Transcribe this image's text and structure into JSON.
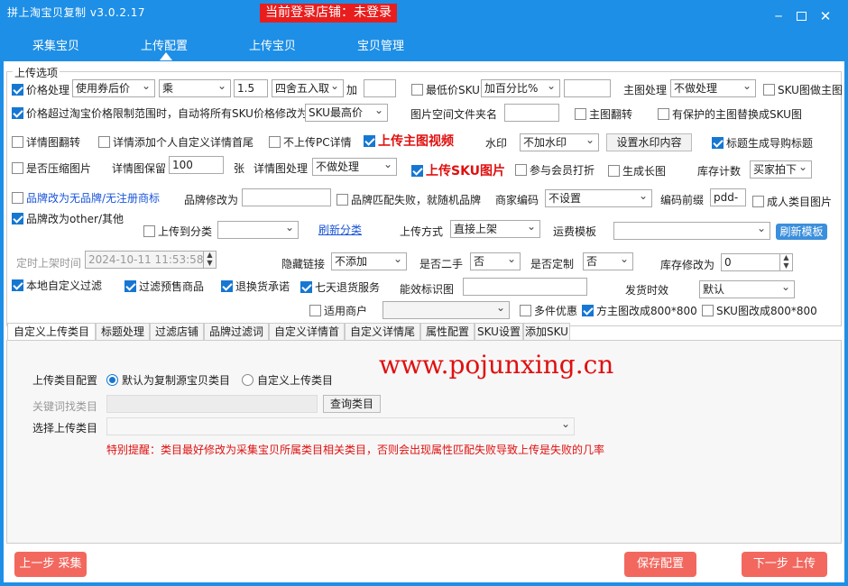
{
  "app": {
    "title": "拼上淘宝贝复制 v3.0.2.17",
    "store_status": "当前登录店铺：未登录"
  },
  "nav": {
    "tabs": [
      "采集宝贝",
      "上传配置",
      "上传宝贝",
      "宝贝管理"
    ],
    "active": "上传配置"
  },
  "options": {
    "group_title": "上传选项",
    "price_processing": {
      "label": "价格处理",
      "checked": true,
      "mode": "使用券后价",
      "operator": "乘",
      "factor": "1.5",
      "rounding": "四舍五入取",
      "add_label": "加",
      "add_value": ""
    },
    "min_price_sku": {
      "label": "最低价SKU",
      "checked": false,
      "mode": "加百分比%",
      "value": ""
    },
    "main_image_processing": {
      "label": "主图处理",
      "value": "不做处理"
    },
    "sku_as_main": {
      "label": "SKU图做主图",
      "checked": false
    },
    "price_limit": {
      "label": "价格超过淘宝价格限制范围时，自动将所有SKU价格修改为",
      "checked": true,
      "value": "SKU最高价"
    },
    "image_folder": {
      "label": "图片空间文件夹名",
      "value": ""
    },
    "main_flip": {
      "label": "主图翻转",
      "checked": false
    },
    "protected_main_replace": {
      "label": "有保护的主图替换成SKU图",
      "checked": false
    },
    "detail_flip": {
      "label": "详情图翻转",
      "checked": false
    },
    "detail_custom_header": {
      "label": "详情添加个人自定义详情首尾",
      "checked": false
    },
    "no_pc_detail": {
      "label": "不上传PC详情",
      "checked": false
    },
    "upload_main_video": {
      "label": "上传主图视频",
      "checked": true
    },
    "watermark": {
      "label": "水印",
      "value": "不加水印",
      "button": "设置水印内容"
    },
    "title_guide": {
      "label": "标题生成导购标题",
      "checked": true
    },
    "compress_images": {
      "label": "是否压缩图片",
      "checked": false
    },
    "detail_keep": {
      "label": "详情图保留",
      "value": "100",
      "unit": "张"
    },
    "detail_processing": {
      "label": "详情图处理",
      "value": "不做处理"
    },
    "upload_sku_images": {
      "label": "上传SKU图片",
      "checked": true
    },
    "member_discount": {
      "label": "参与会员打折",
      "checked": false
    },
    "long_image": {
      "label": "生成长图",
      "checked": false
    },
    "stock_count": {
      "label": "库存计数",
      "value": "买家拍下"
    },
    "brand_none": {
      "label": "品牌改为无品牌/无注册商标",
      "checked": false
    },
    "brand_modify": {
      "label": "品牌修改为",
      "value": ""
    },
    "brand_fail_random": {
      "label": "品牌匹配失败，就随机品牌",
      "checked": false
    },
    "merchant_code": {
      "label": "商家编码",
      "value": "不设置"
    },
    "code_prefix": {
      "label": "编码前缀",
      "value": "pdd-"
    },
    "adult_category": {
      "label": "成人类目图片",
      "checked": false
    },
    "brand_other": {
      "label": "品牌改为other/其他",
      "checked": true
    },
    "upload_to_category": {
      "label": "上传到分类",
      "checked": false,
      "value": ""
    },
    "refresh_category": "刷新分类",
    "upload_mode": {
      "label": "上传方式",
      "value": "直接上架"
    },
    "shipping_template": {
      "label": "运费模板",
      "value": "",
      "button": "刷新模板"
    },
    "scheduled": {
      "label": "定时上架时间",
      "value": "2024-10-11 11:53:58"
    },
    "hidden_link": {
      "label": "隐藏链接",
      "value": "不添加"
    },
    "second_hand": {
      "label": "是否二手",
      "value": "否"
    },
    "customized": {
      "label": "是否定制",
      "value": "否"
    },
    "stock_modify": {
      "label": "库存修改为",
      "value": "0"
    },
    "local_filter": {
      "label": "本地自定义过滤",
      "checked": true
    },
    "filter_presale": {
      "label": "过滤预售商品",
      "checked": true
    },
    "return_promise": {
      "label": "退换货承诺",
      "checked": true
    },
    "seven_day": {
      "label": "七天退货服务",
      "checked": true
    },
    "efficacy_image": {
      "label": "能效标识图",
      "value": ""
    },
    "ship_time": {
      "label": "发货时效",
      "value": "默认"
    },
    "applicable_merchant": {
      "label": "适用商户",
      "checked": false,
      "value": ""
    },
    "multi_discount": {
      "label": "多件优惠",
      "checked": false
    },
    "square_main": {
      "label": "方主图改成800*800",
      "checked": true
    },
    "sku_800": {
      "label": "SKU图改成800*800",
      "checked": false
    }
  },
  "subtabs": [
    "自定义上传类目",
    "标题处理",
    "过滤店铺",
    "品牌过滤词",
    "自定义详情首",
    "自定义详情尾",
    "属性配置",
    "SKU设置",
    "添加SKU"
  ],
  "category": {
    "config_label": "上传类目配置",
    "option_default": "默认为复制源宝贝类目",
    "option_custom": "自定义上传类目",
    "keyword_label": "关键词找类目",
    "keyword_value": "",
    "query_button": "查询类目",
    "select_label": "选择上传类目",
    "select_value": "",
    "warning": "特别提醒：类目最好修改为采集宝贝所属类目相关类目，否则会出现属性匹配失败导致上传是失败的几率"
  },
  "watermark_text": "www.pojunxing.cn",
  "footer": {
    "prev": "上一步 采集",
    "save": "保存配置",
    "next": "下一步 上传"
  }
}
